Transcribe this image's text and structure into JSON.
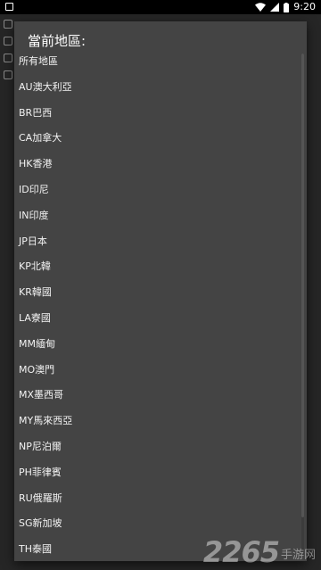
{
  "status_bar": {
    "time": "9:20",
    "icons": [
      "app-notification-icon",
      "wifi-icon",
      "signal-icon",
      "battery-icon"
    ]
  },
  "dialog": {
    "title": "當前地區:",
    "regions": [
      "所有地區",
      "AU澳大利亞",
      "BR巴西",
      "CA加拿大",
      "HK香港",
      "ID印尼",
      "IN印度",
      "JP日本",
      "KP北韓",
      "KR韓國",
      "LA寮國",
      "MM緬甸",
      "MO澳門",
      "MX墨西哥",
      "MY馬來西亞",
      "NP尼泊爾",
      "PH菲律賓",
      "RU俄羅斯",
      "SG新加坡",
      "TH泰國"
    ]
  },
  "watermark": {
    "number": "2265",
    "text": "手游网"
  }
}
